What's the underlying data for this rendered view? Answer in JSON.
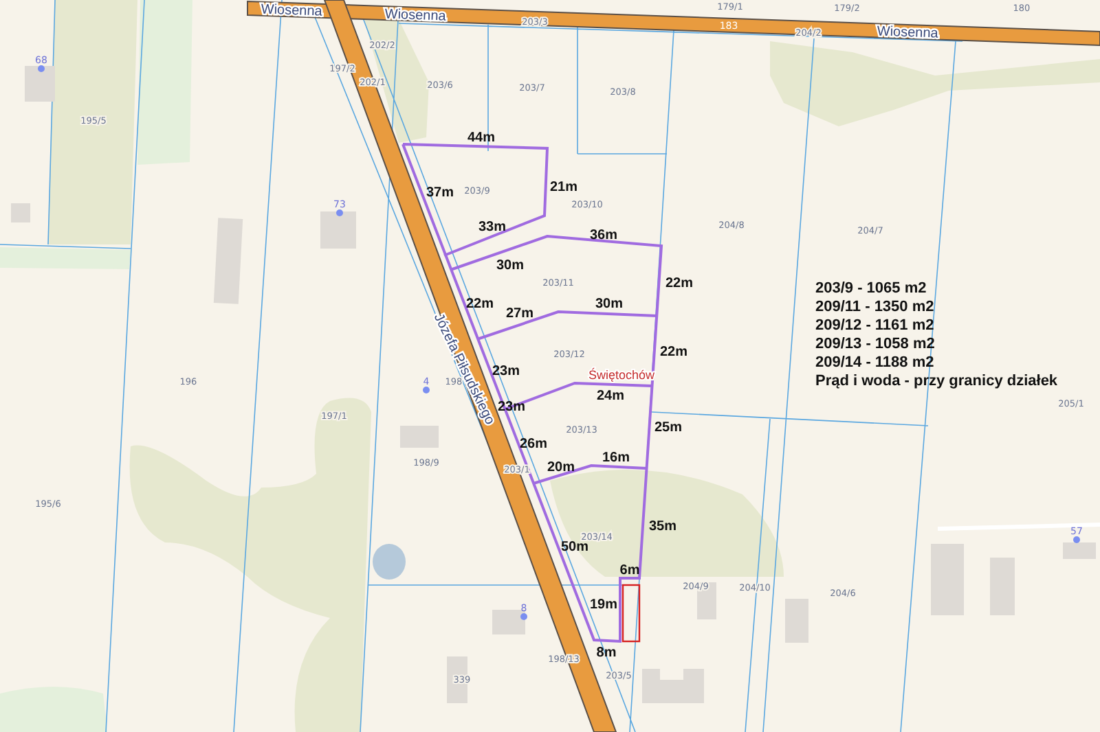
{
  "streets": [
    {
      "name": "Wiosenna"
    },
    {
      "name": "Wiosenna"
    },
    {
      "name": "Wiosenna"
    },
    {
      "name": "Józefa Piłsudskiego"
    }
  ],
  "road_number": "183",
  "parcel_numbers": [
    "195/5",
    "197/2",
    "202/2",
    "202/1",
    "203/3",
    "203/6",
    "203/7",
    "203/8",
    "179/1",
    "179/2",
    "180",
    "204/2",
    "203/9",
    "203/10",
    "204/8",
    "204/7",
    "203/11",
    "203/12",
    "196",
    "197/1",
    "195/6",
    "198",
    "198/9",
    "203/13",
    "203/1",
    "205/1",
    "203/14",
    "204/9",
    "204/10",
    "204/6",
    "198/13",
    "203/5",
    "339"
  ],
  "house_numbers": [
    "68",
    "73",
    "4",
    "8",
    "57"
  ],
  "distances": [
    "44m",
    "37m",
    "21m",
    "33m",
    "36m",
    "30m",
    "22m",
    "22m",
    "27m",
    "30m",
    "22m",
    "23m",
    "24m",
    "23m",
    "25m",
    "26m",
    "16m",
    "20m",
    "35m",
    "50m",
    "6m",
    "19m",
    "8m"
  ],
  "place_name": "Świętochów",
  "legend": [
    "203/9 - 1065 m2",
    "209/11 - 1350 m2",
    "209/12 - 1161 m2",
    "209/13 - 1058 m2",
    "209/14 - 1188 m2",
    "Prąd i woda - przy granicy działek"
  ]
}
